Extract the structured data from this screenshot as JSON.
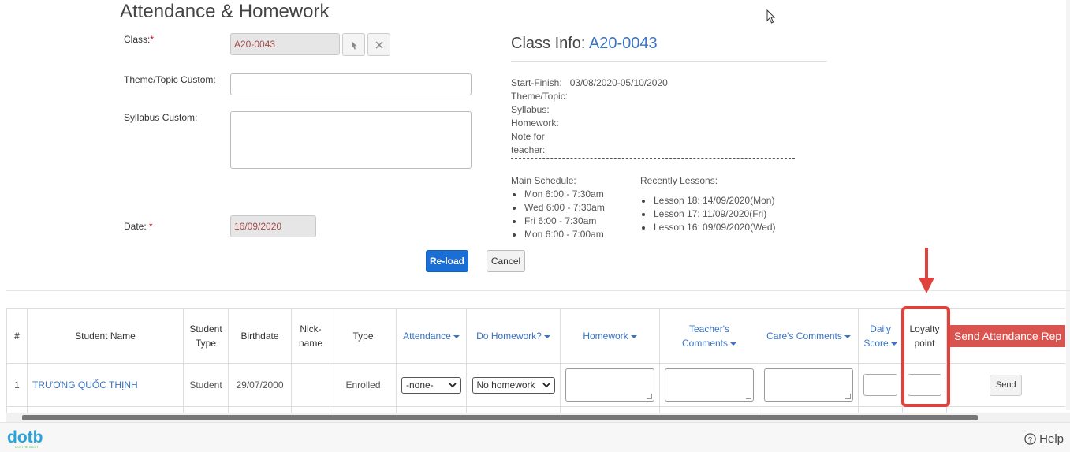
{
  "page_title": "Attendance & Homework",
  "form": {
    "class_label": "Class:",
    "class_value": "A20-0043",
    "theme_label": "Theme/Topic Custom:",
    "theme_value": "",
    "syllabus_label": "Syllabus Custom:",
    "syllabus_value": "",
    "date_label": "Date: ",
    "date_value": "16/09/2020",
    "required_mark": "*",
    "reload_label": "Re-load",
    "cancel_label": "Cancel"
  },
  "class_info": {
    "title_prefix": "Class Info: ",
    "class_code": "A20-0043",
    "start_finish_label": "Start-Finish:",
    "start_finish_value": "03/08/2020-05/10/2020",
    "theme_label": "Theme/Topic:",
    "syllabus_label": "Syllabus:",
    "homework_label": "Homework:",
    "note_label_1": "Note for",
    "note_label_2": "teacher:",
    "main_schedule_label": "Main Schedule:",
    "main_schedule": [
      "Mon 6:00 - 7:30am",
      "Wed 6:00 - 7:30am",
      "Fri 6:00 - 7:30am",
      "Mon 6:00 - 7:00am"
    ],
    "recent_lessons_label": "Recently Lessons:",
    "recent_lessons": [
      "Lesson 18: 14/09/2020(Mon)",
      "Lesson 17: 11/09/2020(Fri)",
      "Lesson 16: 09/09/2020(Wed)"
    ]
  },
  "table": {
    "headers": {
      "num": "#",
      "student_name": "Student Name",
      "student_type_1": "Student",
      "student_type_2": "Type",
      "birthdate": "Birthdate",
      "nick_1": "Nick-",
      "nick_2": "name",
      "type": "Type",
      "attendance": "Attendance",
      "do_homework": "Do Homework?",
      "homework": "Homework",
      "teacher_comments_1": "Teacher's",
      "teacher_comments_2": "Comments",
      "cares_comments": "Care's Comments",
      "daily_score_1": "Daily",
      "daily_score_2": "Score",
      "loyalty_1": "Loyalty",
      "loyalty_2": "point",
      "send_report": "Send Attendance Rep"
    },
    "rows": [
      {
        "num": "1",
        "name": "TRƯƠNG QUỐC THỊNH",
        "student_type": "Student",
        "birthdate": "29/07/2000",
        "nickname": "",
        "type": "Enrolled",
        "attendance": "-none-",
        "do_homework": "No homework",
        "send_label": "Send"
      }
    ]
  },
  "footer": {
    "logo_text": "dotb",
    "logo_tagline": "DO THE BEST",
    "help_label": "Help"
  },
  "colors": {
    "primary": "#1a6fd6",
    "link": "#3b73c4",
    "danger": "#d9534f",
    "highlight": "#e0413d"
  }
}
